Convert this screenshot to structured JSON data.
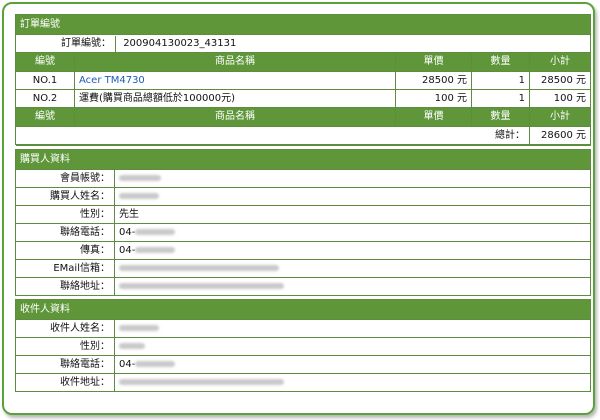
{
  "order": {
    "section_title": "訂單編號",
    "order_label": "訂單編號：",
    "order_number": "200904130023_43131",
    "headers": [
      "編號",
      "商品名稱",
      "單價",
      "數量",
      "小計"
    ],
    "rows": [
      {
        "no": "NO.1",
        "name": "Acer TM4730",
        "price": "28500 元",
        "qty": "1",
        "subtotal": "28500 元"
      },
      {
        "no": "NO.2",
        "name": "運費(購買商品總額低於100000元)",
        "price": "100 元",
        "qty": "1",
        "subtotal": "100 元"
      }
    ],
    "total_label": "總計：",
    "total_value": "28600 元"
  },
  "buyer": {
    "section_title": "購買人資料",
    "fields": [
      {
        "label": "會員帳號：",
        "value": ""
      },
      {
        "label": "購買人姓名：",
        "value": ""
      },
      {
        "label": "性別：",
        "value": "先生"
      },
      {
        "label": "聯絡電話：",
        "value": "04-"
      },
      {
        "label": "傳真：",
        "value": "04-"
      },
      {
        "label": "EMail信箱：",
        "value": ""
      },
      {
        "label": "聯絡地址：",
        "value": ""
      }
    ]
  },
  "recipient": {
    "section_title": "收件人資料",
    "fields": [
      {
        "label": "收件人姓名：",
        "value": ""
      },
      {
        "label": "性別：",
        "value": ""
      },
      {
        "label": "聯絡電話：",
        "value": "04-"
      },
      {
        "label": "收件地址：",
        "value": ""
      }
    ]
  },
  "colors": {
    "header_green": "#5f963a",
    "border_green": "#5e8d3f",
    "frame_green": "#5aa33c",
    "link_blue": "#1f5cb3"
  }
}
